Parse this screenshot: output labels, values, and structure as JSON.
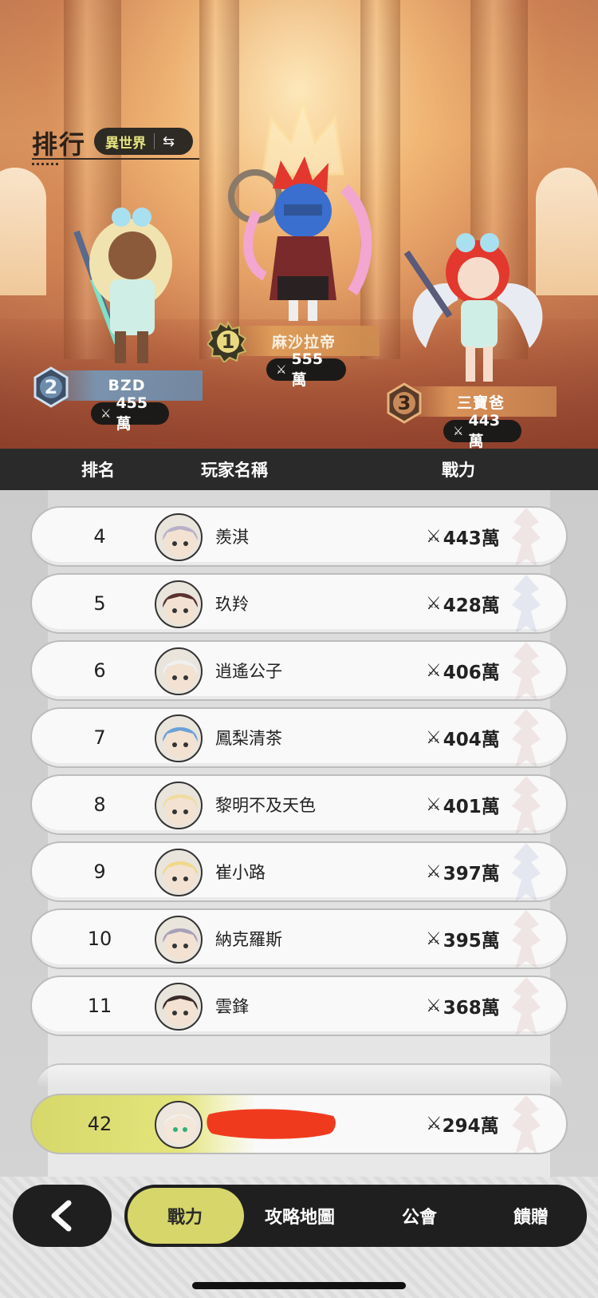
{
  "header": {
    "title": "排行",
    "world_pill": {
      "label": "異世界",
      "swap_icon": "swap-arrows-icon"
    }
  },
  "podium": [
    {
      "rank": "1",
      "name": "麻沙拉帝",
      "power": "555萬",
      "plate_color": "#e0a05c"
    },
    {
      "rank": "2",
      "name": "BZD",
      "power": "455萬",
      "plate_color": "#7b96b4"
    },
    {
      "rank": "3",
      "name": "三寶爸",
      "power": "443萬",
      "plate_color": "#d9945a"
    }
  ],
  "table": {
    "columns": [
      "排名",
      "玩家名稱",
      "戰力"
    ],
    "rows": [
      {
        "rank": "4",
        "name": "羨淇",
        "power": "443萬",
        "emblem_color": "#c98b8b"
      },
      {
        "rank": "5",
        "name": "玖羚",
        "power": "428萬",
        "emblem_color": "#8b97c9"
      },
      {
        "rank": "6",
        "name": "逍遙公子",
        "power": "406萬",
        "emblem_color": "#c98b8b"
      },
      {
        "rank": "7",
        "name": "鳳梨清茶",
        "power": "404萬",
        "emblem_color": "#c98b8b"
      },
      {
        "rank": "8",
        "name": "黎明不及天色",
        "power": "401萬",
        "emblem_color": "#c98b8b"
      },
      {
        "rank": "9",
        "name": "崔小路",
        "power": "397萬",
        "emblem_color": "#8b97c9"
      },
      {
        "rank": "10",
        "name": "納克羅斯",
        "power": "395萬",
        "emblem_color": "#c98b8b"
      },
      {
        "rank": "11",
        "name": "雲鋒",
        "power": "368萬",
        "emblem_color": "#c98b8b"
      }
    ],
    "my_row": {
      "rank": "42",
      "power": "294萬"
    }
  },
  "nav": {
    "tabs": [
      {
        "label": "戰力",
        "active": true
      },
      {
        "label": "攻略地圖",
        "active": false
      },
      {
        "label": "公會",
        "active": false
      },
      {
        "label": "饋贈",
        "active": false
      }
    ]
  },
  "colors": {
    "accent": "#d6d66a",
    "dark": "#1f1f1f",
    "redaction": "#f03a1e"
  },
  "icons": {
    "power": "crossed-swords-icon",
    "back": "chevron-left-icon"
  }
}
